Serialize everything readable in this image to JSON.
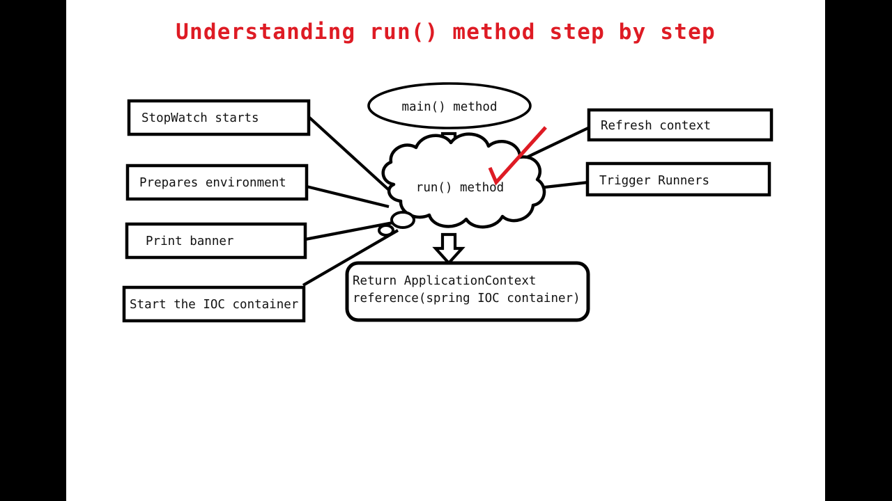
{
  "slide": {
    "title": "Understanding run() method step by step",
    "title_color": "#DE1B24",
    "background_color": "#FFFFFF",
    "letterbox_color": "#000000",
    "stroke_color": "#000000"
  },
  "nodes": {
    "main_method": {
      "label": "main() method",
      "shape": "ellipse"
    },
    "run_method": {
      "label": "run() method",
      "shape": "cloud"
    },
    "return_box": {
      "line1": "Return ApplicationContext",
      "line2": "reference(spring IOC container)",
      "shape": "rounded-rectangle"
    }
  },
  "left_steps": [
    {
      "label": "StopWatch starts"
    },
    {
      "label": "Prepares environment"
    },
    {
      "label": "Print banner"
    },
    {
      "label": "Start the IOC container"
    }
  ],
  "right_steps": [
    {
      "label": "Refresh context"
    },
    {
      "label": "Trigger Runners"
    }
  ],
  "annotations": {
    "red_check": {
      "name": "red-check-mark",
      "color": "#DE1B24"
    }
  },
  "arrows": [
    {
      "name": "arrow-main-to-run",
      "direction": "down"
    },
    {
      "name": "arrow-run-to-return",
      "direction": "down"
    }
  ]
}
